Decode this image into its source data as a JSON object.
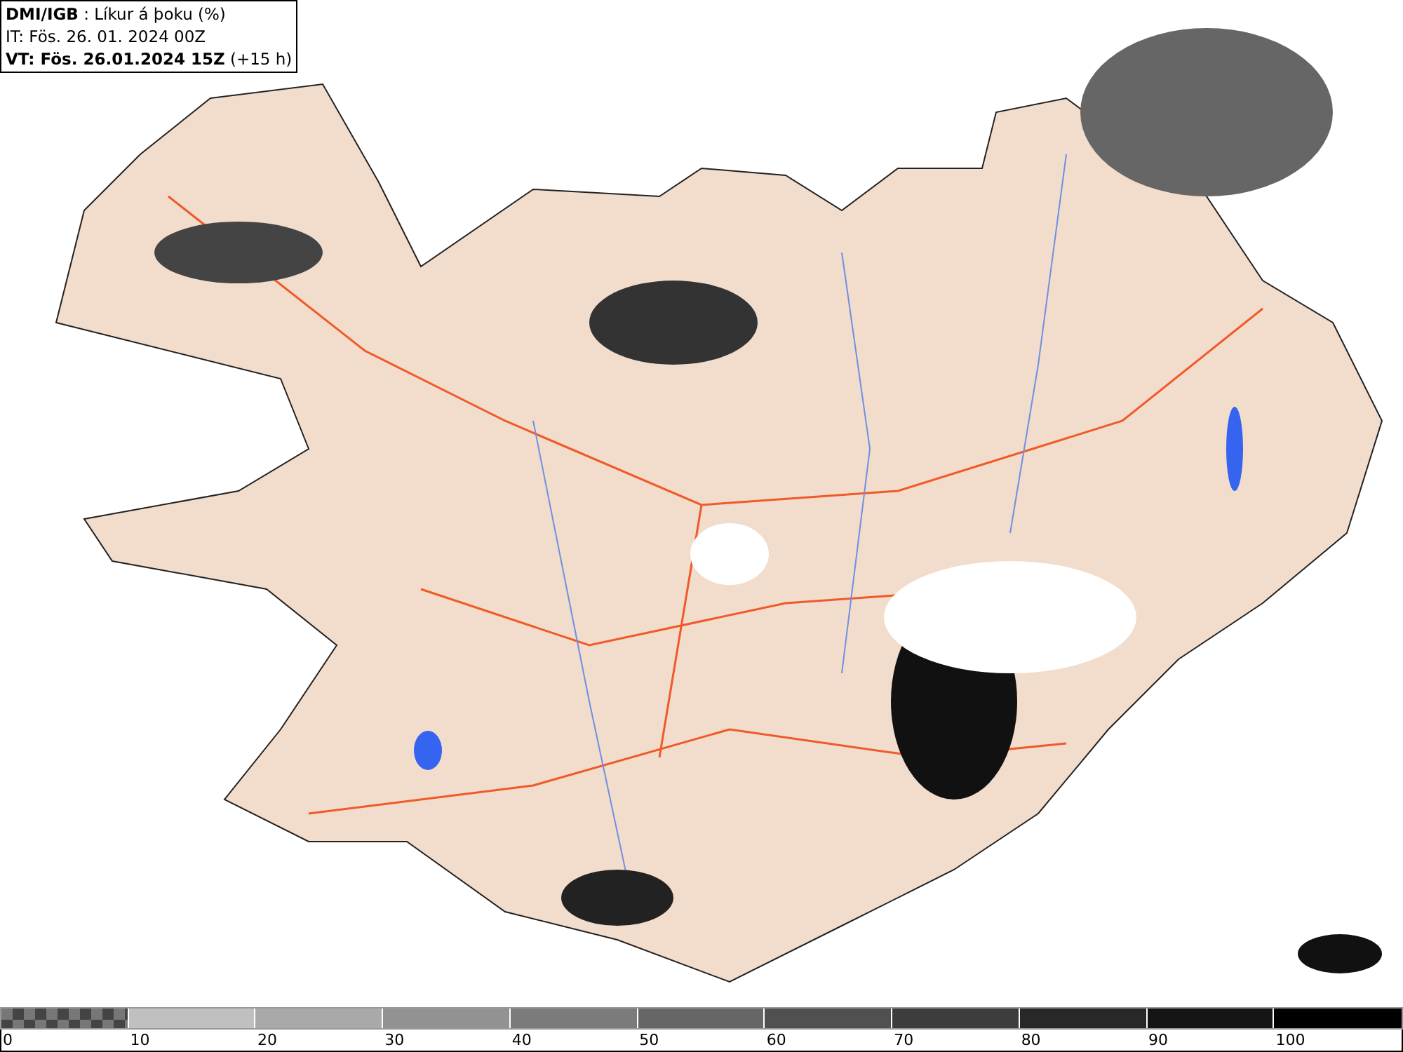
{
  "header": {
    "lines": [
      "**DMI/IGB** : Líkur á þoku (%)",
      "IT: Fös. 26. 01. 2024 00Z",
      "**VT: Fös. 26.01.2024 15Z** (+15 h)"
    ]
  },
  "legend": {
    "segments": [
      {
        "kind": "checkered",
        "color": "#777777"
      },
      {
        "kind": "solid",
        "color": "#c0c0c0"
      },
      {
        "kind": "solid",
        "color": "#a9a9a9"
      },
      {
        "kind": "solid",
        "color": "#929292"
      },
      {
        "kind": "solid",
        "color": "#7b7b7b"
      },
      {
        "kind": "solid",
        "color": "#666666"
      },
      {
        "kind": "solid",
        "color": "#505050"
      },
      {
        "kind": "solid",
        "color": "#3d3d3d"
      },
      {
        "kind": "solid",
        "color": "#282828"
      },
      {
        "kind": "solid",
        "color": "#151515"
      },
      {
        "kind": "solid",
        "color": "#000000"
      }
    ],
    "labels": [
      "0",
      "10",
      "20",
      "30",
      "40",
      "50",
      "60",
      "70",
      "80",
      "90",
      "100"
    ]
  }
}
